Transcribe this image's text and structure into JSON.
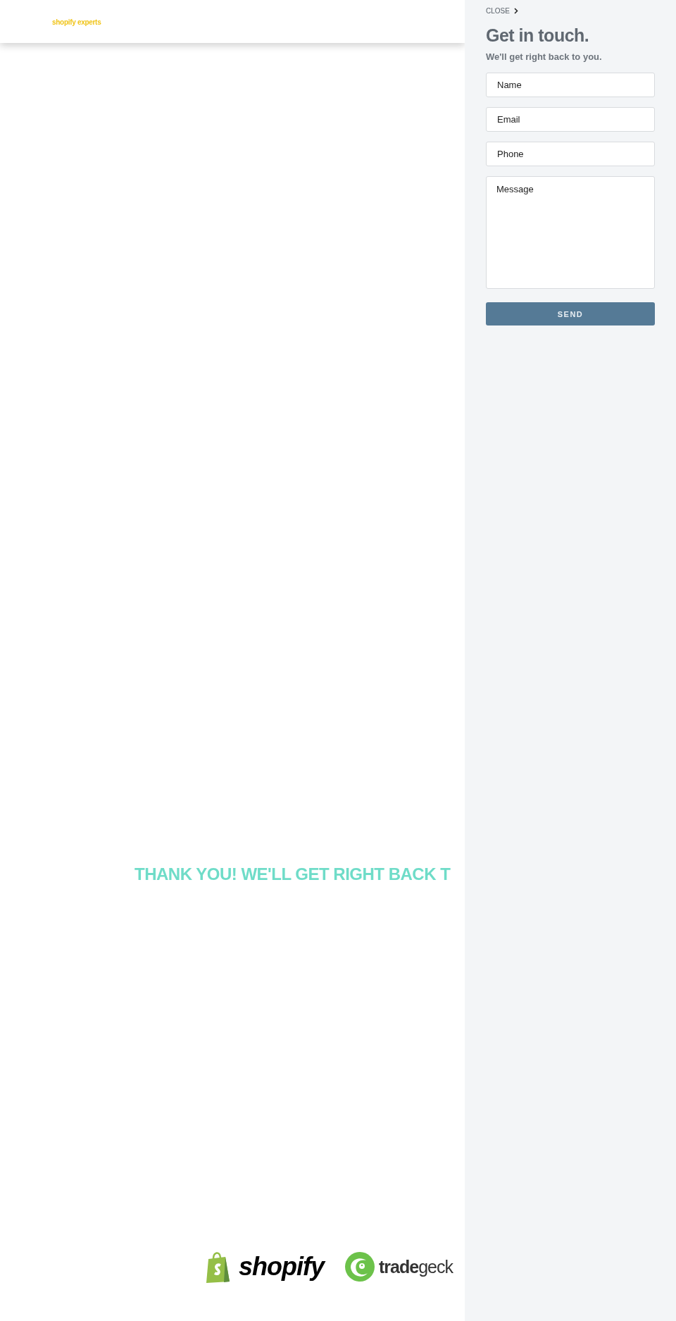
{
  "header": {
    "logo": "shopify experts"
  },
  "message": "THANK YOU! WE'LL GET RIGHT BACK T",
  "partners": [
    {
      "kind": "shopify",
      "name": "shopify"
    },
    {
      "kind": "tradegecko",
      "name": "**trade**geck"
    }
  ],
  "panel": {
    "close": "CLOSE",
    "title": "Get in touch.",
    "subtitle": "We'll get right back to you.",
    "fields": [
      {
        "kind": "input",
        "placeholder": "Name"
      },
      {
        "kind": "input",
        "placeholder": "Email"
      },
      {
        "kind": "input",
        "placeholder": "Phone"
      },
      {
        "kind": "textarea",
        "placeholder": "Message"
      }
    ],
    "button": "SEND"
  }
}
